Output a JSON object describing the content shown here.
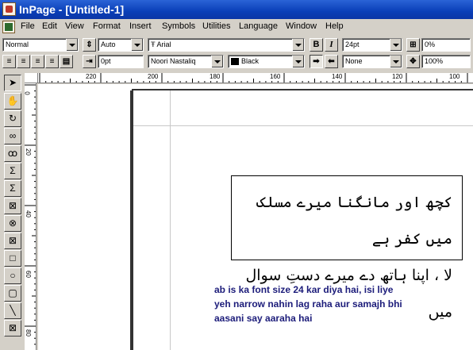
{
  "window": {
    "title": "InPage - [Untitled-1]"
  },
  "menu": [
    "File",
    "Edit",
    "View",
    "Format",
    "Insert",
    "Symbols",
    "Utilities",
    "Language",
    "Window",
    "Help"
  ],
  "toolbar1": {
    "style": "Normal",
    "leading": "Auto",
    "font": "Arial",
    "bold": "B",
    "italic": "I",
    "size": "24pt",
    "tracking": "0%"
  },
  "toolbar2": {
    "indent": "0pt",
    "urdu_font": "Noori Nastaliq",
    "color": "Black",
    "shade": "None",
    "scale": "100%"
  },
  "ruler_h": [
    "220",
    "200",
    "180",
    "160",
    "140",
    "120",
    "100"
  ],
  "ruler_v": [
    "0",
    "20",
    "40",
    "60",
    "80"
  ],
  "document": {
    "urdu_line1": "کچھ اور مانگنا میرے مسلک میں کفر ہے",
    "urdu_line2": "لا ، اپنا ہاتھ دے میرے دستِ سوال میں",
    "note_line1": "ab is ka font size 24 kar diya hai, isi liye",
    "note_line2": "yeh narrow nahin lag raha aur samajh bhi",
    "note_line3": "aasani say aaraha hai"
  },
  "colors": {
    "titlebar": "#0a3fb8",
    "note_text": "#1c1c7a"
  }
}
